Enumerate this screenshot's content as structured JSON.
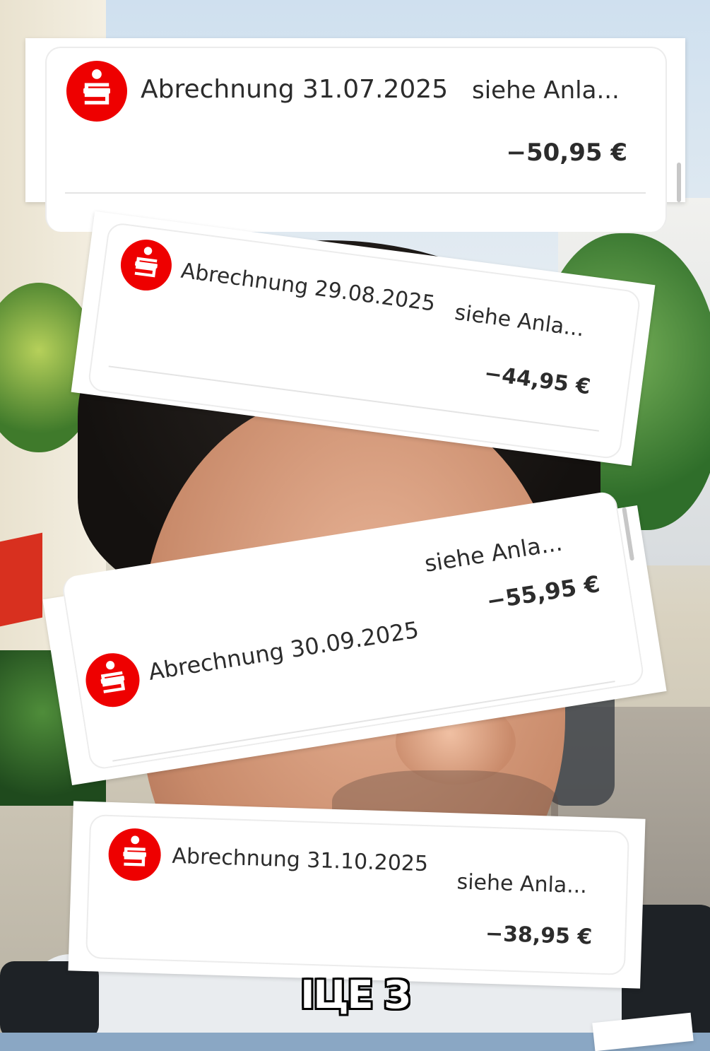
{
  "cards": [
    {
      "title": "Abrechnung 31.07.2025",
      "reference": "siehe Anla...",
      "amount": "−50,95 €"
    },
    {
      "title": "Abrechnung 29.08.2025",
      "reference": "siehe Anla...",
      "amount": "−44,95 €"
    },
    {
      "title": "Abrechnung 30.09.2025",
      "reference": "siehe Anla...",
      "amount": "−55,95 €"
    },
    {
      "title": "Abrechnung 31.10.2025",
      "reference": "siehe Anla...",
      "amount": "−38,95 €"
    }
  ],
  "caption": "ІЦЕ З",
  "colors": {
    "brand_red": "#ee0000",
    "text": "#2c2c2c",
    "card_bg": "#ffffff"
  },
  "icons": {
    "bank_logo": "sparkasse-logo-icon"
  }
}
